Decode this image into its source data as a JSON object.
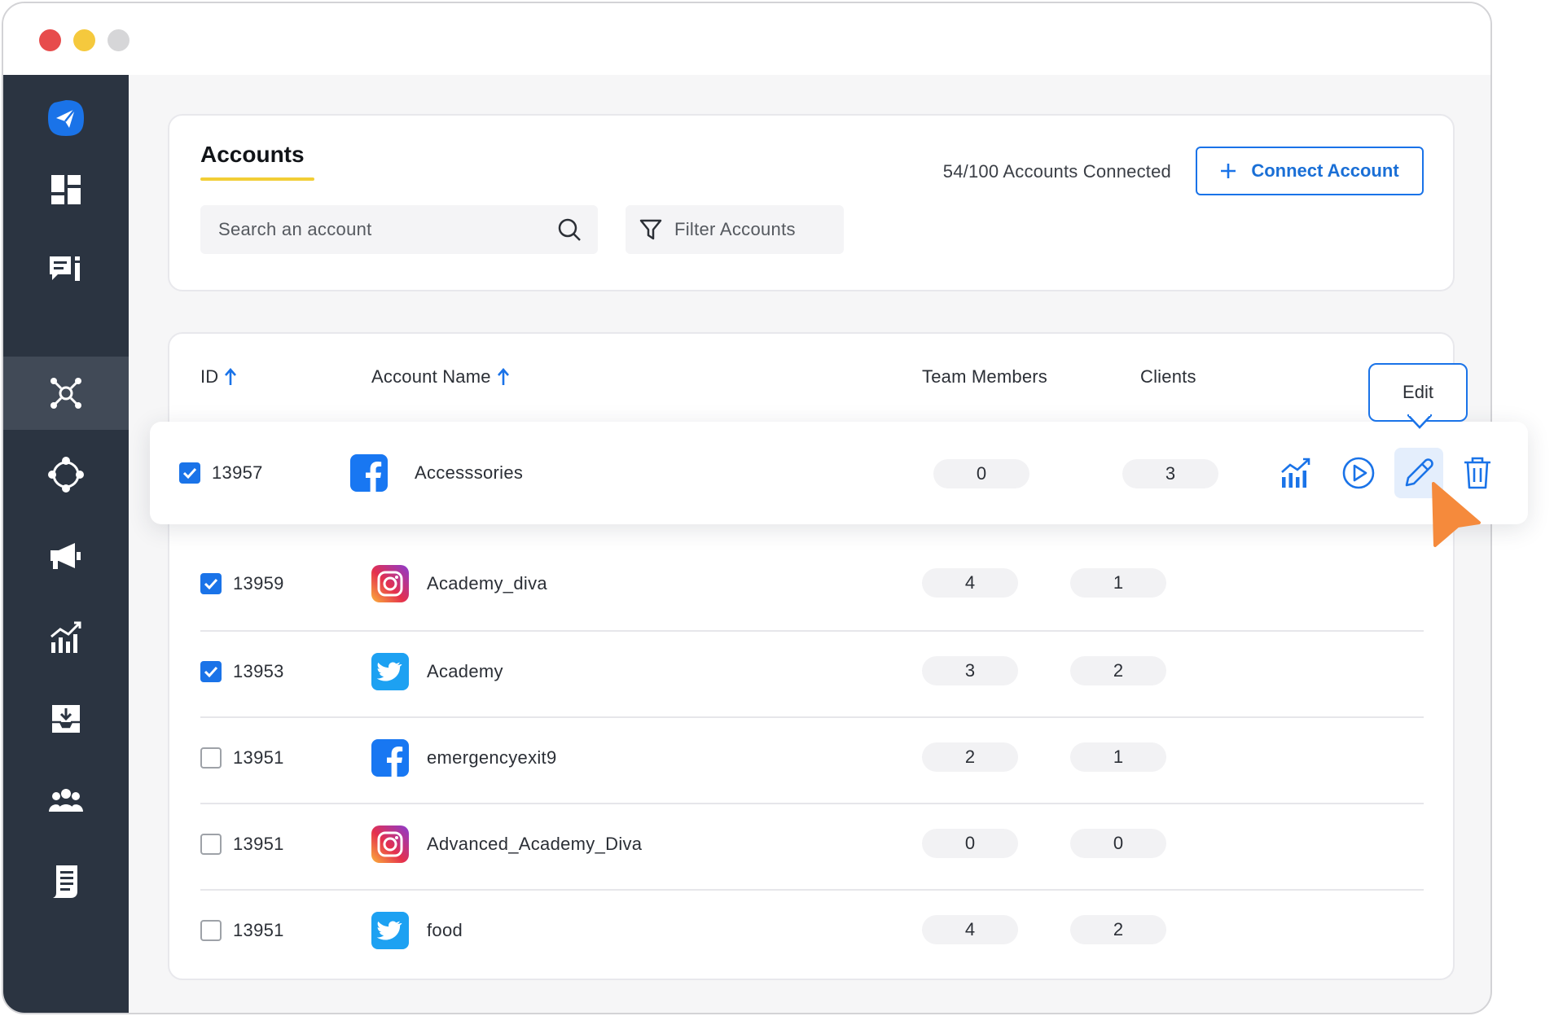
{
  "colors": {
    "brand_blue": "#1a73e8",
    "sidebar_bg": "#2b3441",
    "underline_yellow": "#f2ce35",
    "cursor_orange": "#f58a3c"
  },
  "window_controls": [
    "close-dot",
    "minimize-dot",
    "maximize-dot"
  ],
  "sidebar": {
    "items": [
      {
        "icon": "paper-plane-logo-icon",
        "active": false
      },
      {
        "icon": "dashboard-grid-icon",
        "active": false
      },
      {
        "icon": "message-compose-icon",
        "active": false
      },
      {
        "icon": "network-hub-icon",
        "active": true
      },
      {
        "icon": "connected-circle-icon",
        "active": false
      },
      {
        "icon": "megaphone-icon",
        "active": false
      },
      {
        "icon": "analytics-icon",
        "active": false
      },
      {
        "icon": "inbox-download-icon",
        "active": false
      },
      {
        "icon": "team-icon",
        "active": false
      },
      {
        "icon": "report-document-icon",
        "active": false
      }
    ]
  },
  "header": {
    "title": "Accounts",
    "search_placeholder": "Search an account",
    "filter_label": "Filter Accounts",
    "connected_text": "54/100 Accounts Connected",
    "connect_label": "Connect Account"
  },
  "table": {
    "columns": {
      "id": "ID",
      "name": "Account Name",
      "team": "Team Members",
      "clients": "Clients"
    },
    "sort_icons": [
      "sort-up-arrow-icon",
      "sort-up-arrow-icon"
    ],
    "rows": [
      {
        "checked": true,
        "id": "13957",
        "platform": "facebook",
        "name": "Accesssories",
        "team": "0",
        "clients": "3"
      },
      {
        "checked": true,
        "id": "13959",
        "platform": "instagram",
        "name": "Academy_diva",
        "team": "4",
        "clients": "1"
      },
      {
        "checked": true,
        "id": "13953",
        "platform": "twitter",
        "name": "Academy",
        "team": "3",
        "clients": "2"
      },
      {
        "checked": false,
        "id": "13951",
        "platform": "facebook",
        "name": "emergencyexit9",
        "team": "2",
        "clients": "1"
      },
      {
        "checked": false,
        "id": "13951",
        "platform": "instagram",
        "name": "Advanced_Academy_Diva",
        "team": "0",
        "clients": "0"
      },
      {
        "checked": false,
        "id": "13951",
        "platform": "twitter",
        "name": "food",
        "team": "4",
        "clients": "2"
      }
    ],
    "row_actions": [
      "analytics-chart-icon",
      "play-circle-icon",
      "edit-pencil-icon",
      "trash-icon"
    ],
    "hovered_action": "edit-pencil-icon"
  },
  "tooltip": {
    "text": "Edit"
  }
}
